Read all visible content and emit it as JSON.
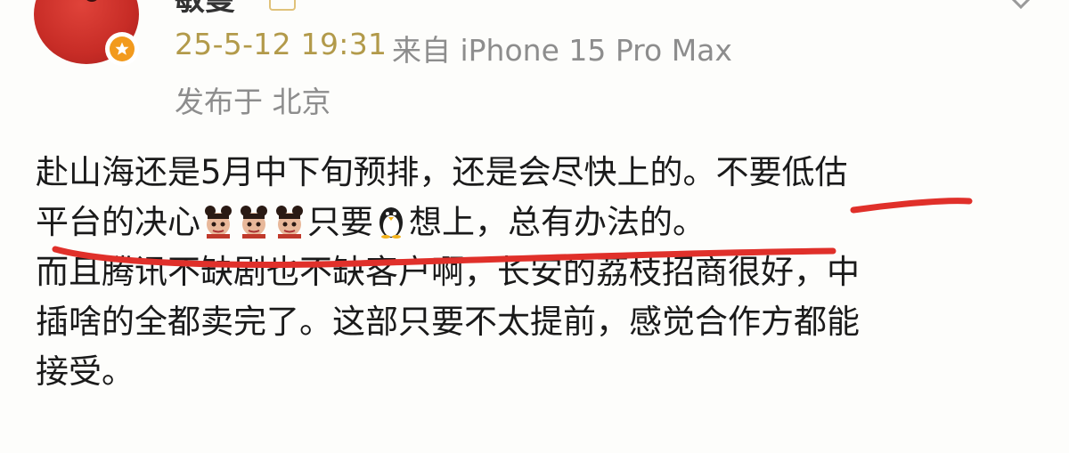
{
  "post": {
    "author_name": "敏曼",
    "time": "25-5-12 19:31",
    "source": "来自 iPhone 15 Pro Max",
    "location": "发布于 北京"
  },
  "content": {
    "line1": "赴山海还是5月中下旬预排，还是会尽快上的。不要低估",
    "line2_a": "平台的决心",
    "line2_b": "只要",
    "line2_c": "想上，总有办法的。",
    "line3": "而且腾讯不缺剧也不缺客户啊，长安的荔枝招商很好，中",
    "line4": "插啥的全都卖完了。这部只要不太提前，感觉合作方都能",
    "line5": "接受。"
  },
  "icons": {
    "avatar": "red-character-avatar",
    "badge": "orange-verified-badge",
    "emoji_character": "nezha-emoji",
    "emoji_penguin": "penguin-emoji",
    "chevron": "chevron-down-icon"
  },
  "colors": {
    "time_color": "#b29a4a",
    "meta_color": "#8d8d8d",
    "underline_color": "#e0302a"
  }
}
